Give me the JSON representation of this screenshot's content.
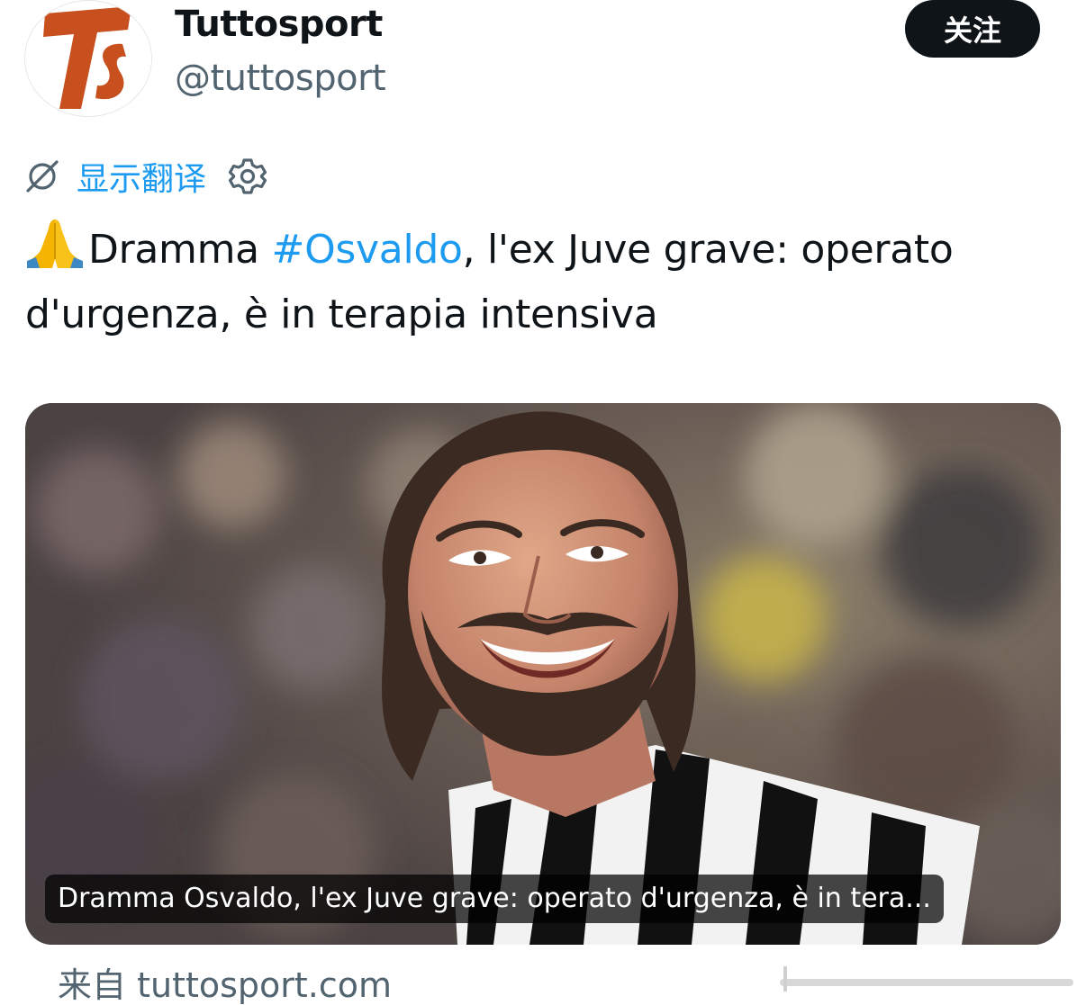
{
  "account": {
    "display_name": "Tuttosport",
    "handle": "@tuttosport",
    "avatar_logo": "TS logo"
  },
  "follow_button": {
    "label": "关注"
  },
  "translate": {
    "icon": "translate-globe-icon",
    "label": "显示翻译",
    "settings_icon": "gear-icon"
  },
  "tweet": {
    "emoji": "folded-hands-emoji",
    "text_before": "Dramma ",
    "hashtag": "#Osvaldo",
    "text_after": ", l'ex Juve grave: operato d'urgenza, è in terapia intensiva"
  },
  "link_card": {
    "caption": "Dramma Osvaldo, l'ex Juve grave: operato d'urgenza, è in tera...",
    "source": "来自 tuttosport.com"
  },
  "colors": {
    "accent": "#1d9bf0",
    "text_primary": "#0f1419",
    "text_secondary": "#536471",
    "button_bg": "#0f1419",
    "logo_orange": "#c8501e"
  }
}
